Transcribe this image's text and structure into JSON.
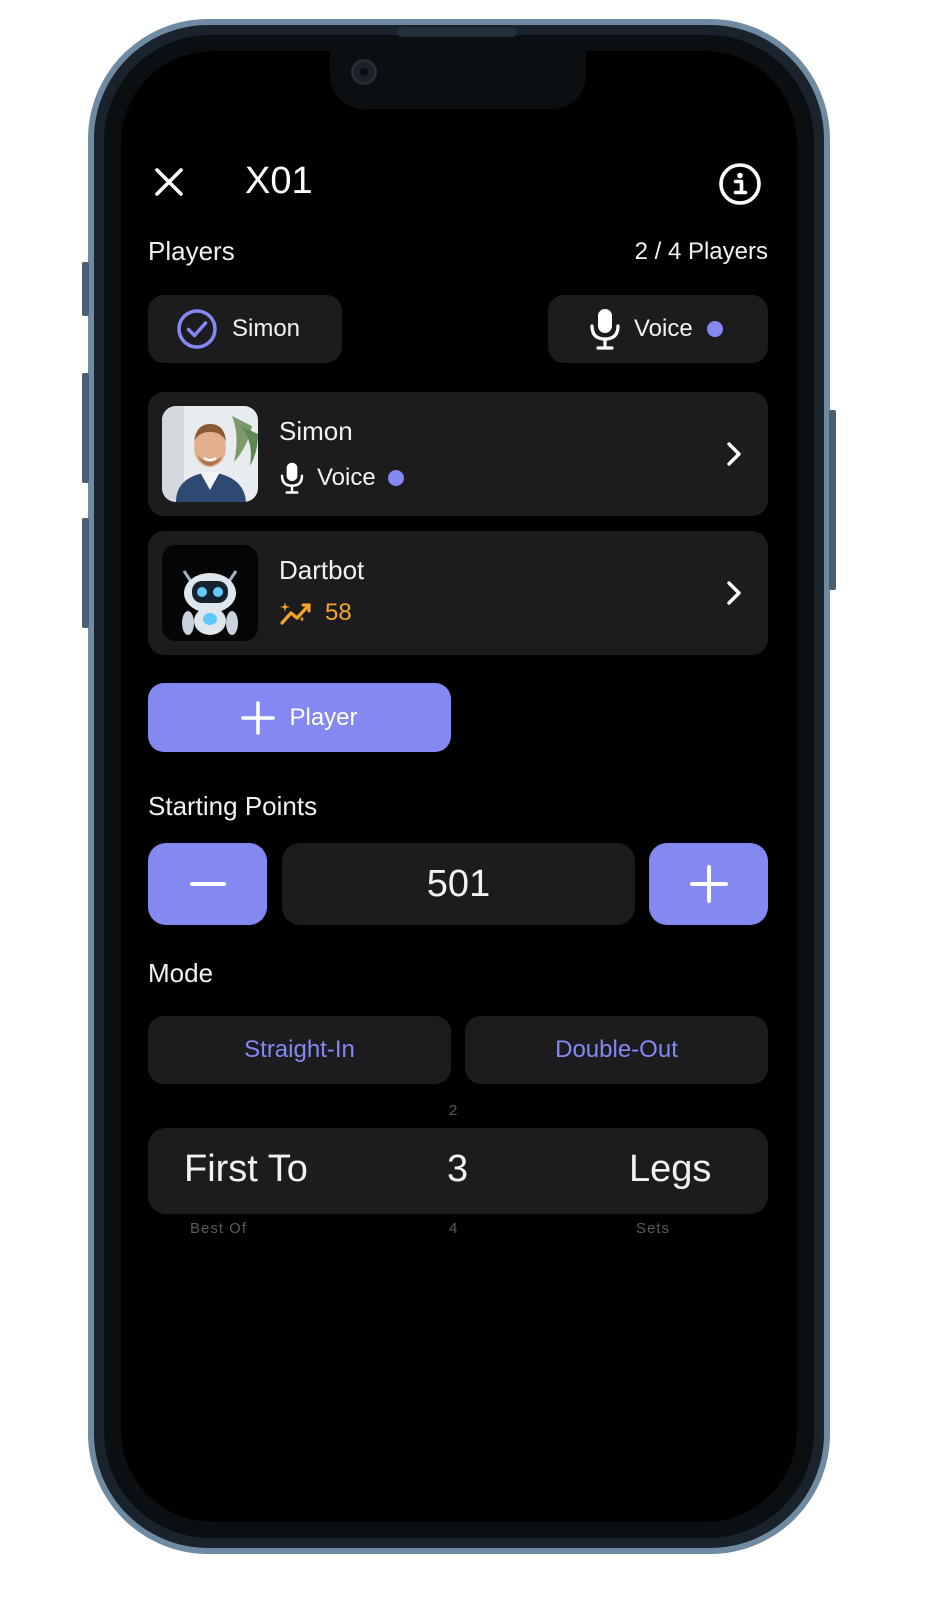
{
  "header": {
    "title": "X01"
  },
  "players_section": {
    "label": "Players",
    "count": "2 / 4 Players",
    "chips": {
      "simon_label": "Simon",
      "voice_label": "Voice"
    },
    "players": [
      {
        "name": "Simon",
        "subtitle": "Voice",
        "subtitle_icon": "microphone-icon",
        "status_dot": true
      },
      {
        "name": "Dartbot",
        "subtitle": "58",
        "subtitle_icon": "sparkle-chart-icon"
      }
    ],
    "add_player_label": "Player"
  },
  "starting_points": {
    "label": "Starting Points",
    "value": "501"
  },
  "mode": {
    "label": "Mode",
    "options": [
      "Straight-In",
      "Double-Out"
    ]
  },
  "match_picker": {
    "above": {
      "number": "2"
    },
    "selected": {
      "type": "First To",
      "number": "3",
      "unit": "Legs"
    },
    "below": {
      "type": "Best Of",
      "number": "4",
      "unit": "Sets"
    }
  },
  "colors": {
    "accent": "#8489f2",
    "card": "#1c1c1f",
    "orange": "#f5a623",
    "background": "#000000"
  }
}
